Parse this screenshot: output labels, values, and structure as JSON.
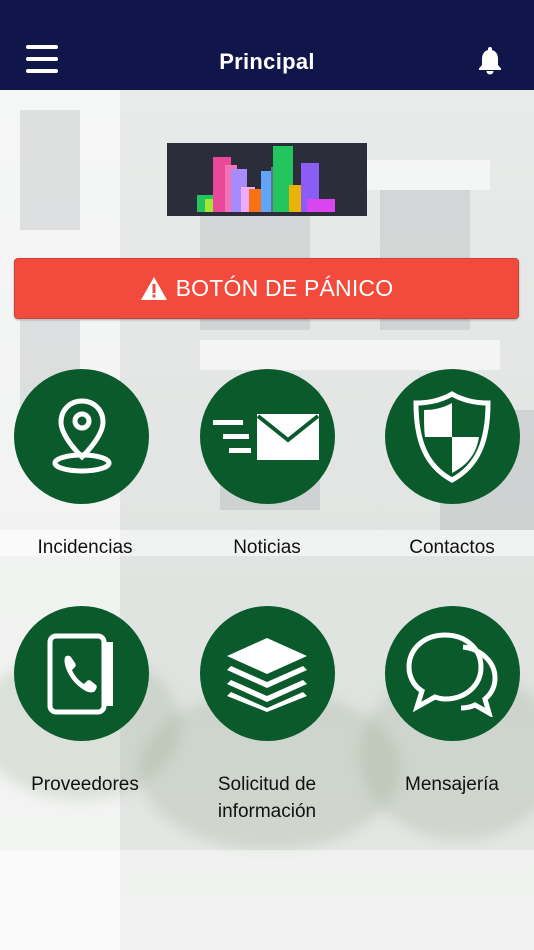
{
  "header": {
    "title": "Principal",
    "menu_icon": "hamburger-menu-icon",
    "notification_icon": "bell-icon"
  },
  "panic_button": {
    "label": "BOTÓN DE PÁNICO",
    "icon": "warning-triangle-icon",
    "color": "#f24a3c"
  },
  "menu": [
    {
      "label": "Incidencias",
      "icon": "location-pin-icon"
    },
    {
      "label": "Noticias",
      "icon": "fast-mail-icon"
    },
    {
      "label": "Contactos",
      "icon": "shield-icon"
    },
    {
      "label": "Proveedores",
      "icon": "phone-book-icon"
    },
    {
      "label": "Solicitud de información",
      "icon": "layers-icon"
    },
    {
      "label": "Mensajería",
      "icon": "chat-bubbles-icon"
    }
  ],
  "colors": {
    "navbar": "#11164a",
    "tile": "#0b5a2c",
    "panic": "#f24a3c"
  }
}
